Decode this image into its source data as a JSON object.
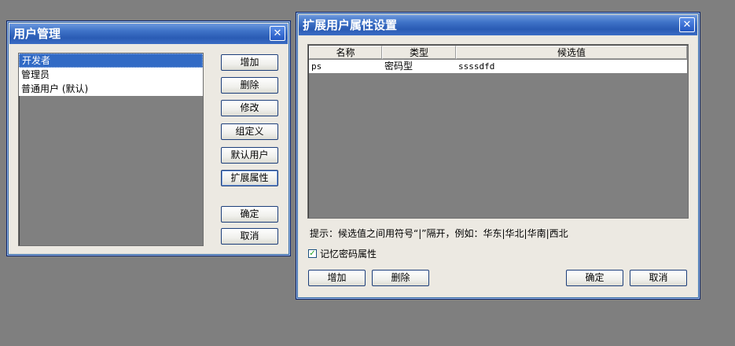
{
  "user_dialog": {
    "title": "用户管理",
    "users": [
      "开发者",
      "管理员",
      "普通用户 (默认)"
    ],
    "selected_index": 0,
    "buttons": {
      "add": "增加",
      "delete": "删除",
      "edit": "修改",
      "group_define": "组定义",
      "default_user": "默认用户",
      "extend_attr": "扩展属性",
      "ok": "确定",
      "cancel": "取消"
    }
  },
  "attr_dialog": {
    "title": "扩展用户属性设置",
    "columns": [
      "名称",
      "类型",
      "候选值"
    ],
    "rows": [
      {
        "name": "ps",
        "type": "密码型",
        "candidates": "ssssdfd"
      }
    ],
    "hint": "提示：候选值之间用符号“|”隔开，例如：华东|华北|华南|西北",
    "remember_label": "记忆密码属性",
    "remember_checked": true,
    "buttons": {
      "add": "增加",
      "delete": "删除",
      "ok": "确定",
      "cancel": "取消"
    }
  },
  "icons": {
    "close": "✕",
    "check": "✓"
  }
}
